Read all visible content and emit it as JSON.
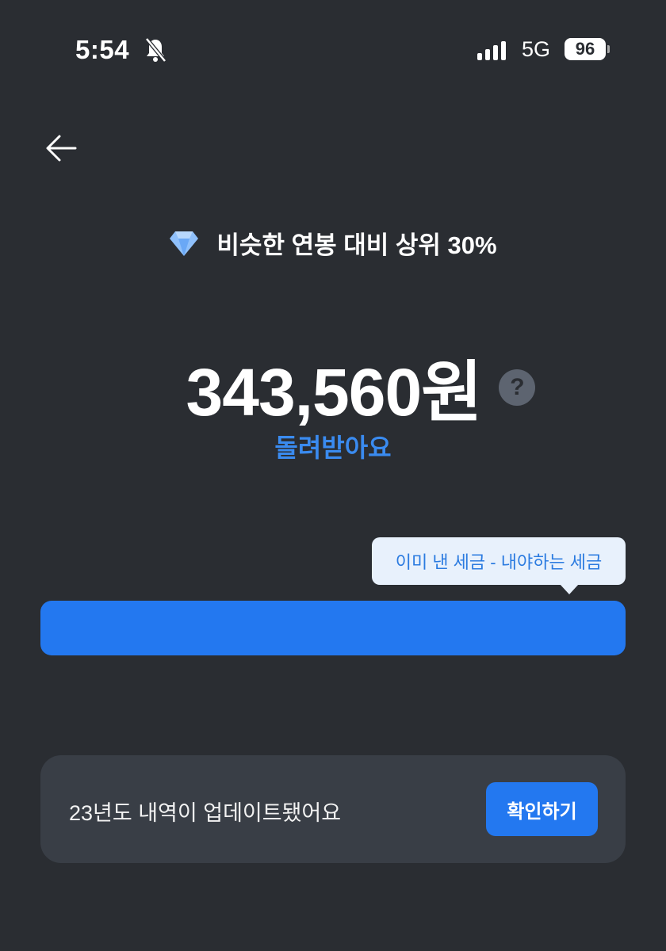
{
  "status_bar": {
    "time": "5:54",
    "network": "5G",
    "battery": "96"
  },
  "header": {
    "back_icon": "arrow-left-icon"
  },
  "summary": {
    "rank_icon": "diamond-icon",
    "rank_text": "비슷한 연봉 대비 상위 30%",
    "amount": "343,560원",
    "help_label": "?",
    "subtitle": "돌려받아요"
  },
  "tooltip": {
    "text": "이미 낸 세금 - 내야하는 세금"
  },
  "bar": {
    "fill_percent": 100,
    "color": "#2378f0"
  },
  "notice": {
    "text": "23년도 내역이 업데이트됐어요",
    "button_label": "확인하기"
  }
}
